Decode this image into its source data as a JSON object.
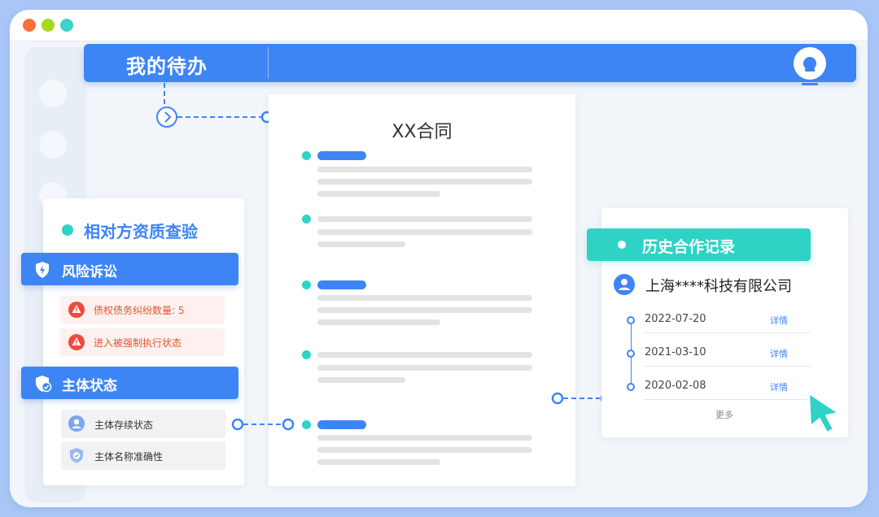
{
  "theme": {
    "primary": "#3d85f5",
    "teal": "#2ed3c6",
    "danger": "#f04a3e",
    "traffic_red": "#f86f3a",
    "traffic_yellow": "#a6d81c",
    "traffic_green": "#3dd3c8"
  },
  "header": {
    "title": "我的待办"
  },
  "document": {
    "title": "XX合同"
  },
  "counterparty_check": {
    "title": "相对方资质查验",
    "risk_section": {
      "title": "风险诉讼",
      "items": [
        "债权债务纠纷数量: 5",
        "进入被强制执行状态"
      ]
    },
    "status_section": {
      "title": "主体状态",
      "items": [
        "主体存续状态",
        "主体名称准确性"
      ]
    }
  },
  "history": {
    "title": "历史合作记录",
    "company": "上海****科技有限公司",
    "records": [
      {
        "date": "2022-07-20",
        "action": "详情"
      },
      {
        "date": "2021-03-10",
        "action": "详情"
      },
      {
        "date": "2020-02-08",
        "action": "详情"
      }
    ],
    "more_label": "更多"
  }
}
